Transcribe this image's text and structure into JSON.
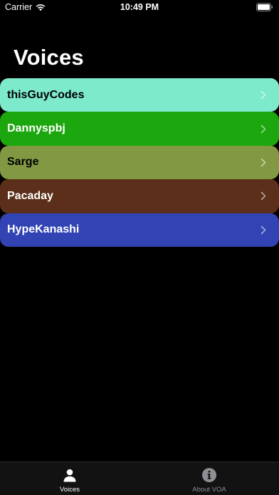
{
  "status_bar": {
    "carrier": "Carrier",
    "time": "10:49 PM",
    "icons": [
      "wifi-icon",
      "battery-icon"
    ]
  },
  "page_title": "Voices",
  "voices": [
    {
      "name": "thisGuyCodes",
      "bg": "#7DEACB",
      "text_color": "#000000"
    },
    {
      "name": "Dannyspbj",
      "bg": "#1DA70E",
      "text_color": "#FFFFFF"
    },
    {
      "name": "Sarge",
      "bg": "#839843",
      "text_color": "#000000"
    },
    {
      "name": "Pacaday",
      "bg": "#5B2F19",
      "text_color": "#FFFFFF"
    },
    {
      "name": "HypeKanashi",
      "bg": "#3244B4",
      "text_color": "#FFFFFF"
    }
  ],
  "tab_bar": {
    "tabs": [
      {
        "label": "Voices",
        "icon": "person-icon",
        "selected": true,
        "color": "#FFFFFF"
      },
      {
        "label": "About VOA",
        "icon": "info-circle-icon",
        "selected": false,
        "color": "#8E8E93"
      }
    ]
  }
}
